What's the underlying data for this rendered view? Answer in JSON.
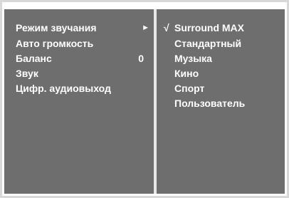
{
  "menu": {
    "items": [
      {
        "label": "Режим звучания",
        "value": "",
        "arrow": "►"
      },
      {
        "label": "Авто громкость",
        "value": "",
        "arrow": ""
      },
      {
        "label": "Баланс",
        "value": "0",
        "arrow": ""
      },
      {
        "label": "Звук",
        "value": "",
        "arrow": ""
      },
      {
        "label": "Цифр. аудиовыход",
        "value": "",
        "arrow": ""
      }
    ]
  },
  "submenu": {
    "check_mark": "√",
    "options": [
      {
        "label": "Surround MAX",
        "selected": true
      },
      {
        "label": "Стандартный",
        "selected": false
      },
      {
        "label": "Музыка",
        "selected": false
      },
      {
        "label": "Кино",
        "selected": false
      },
      {
        "label": "Спорт",
        "selected": false
      },
      {
        "label": "Пользователь",
        "selected": false
      }
    ]
  },
  "colors": {
    "panel": "#6e6e6e",
    "text": "#ffffff",
    "frame": "#d8d8d8"
  }
}
